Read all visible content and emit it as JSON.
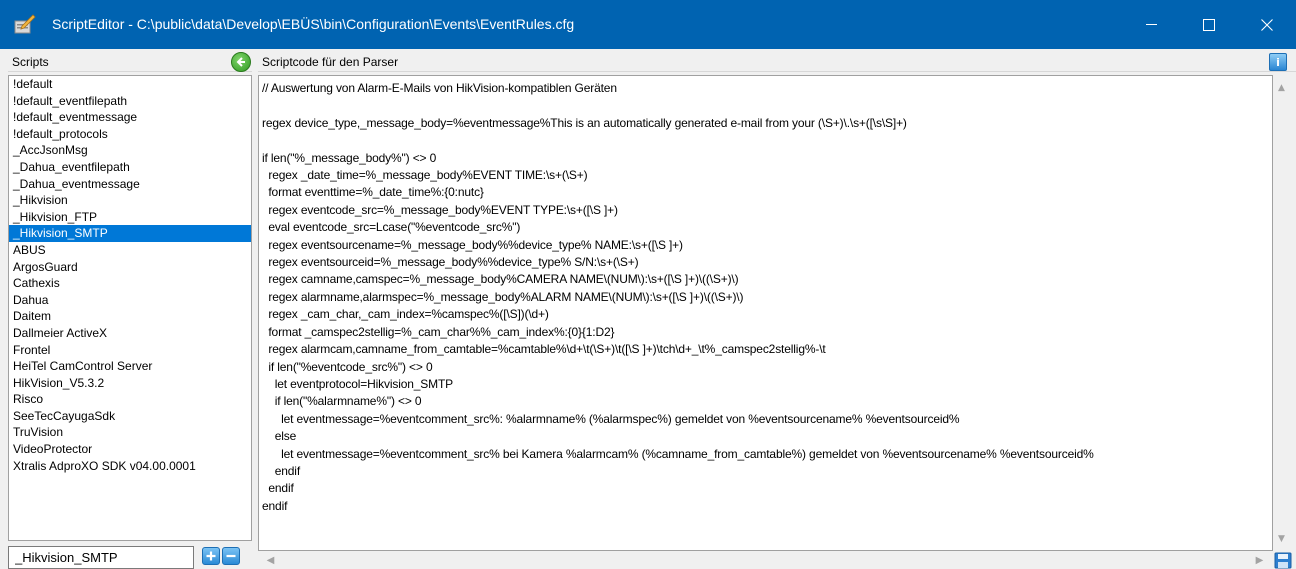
{
  "window": {
    "title": "ScriptEditor - C:\\public\\data\\Develop\\EBÜS\\bin\\Configuration\\Events\\EventRules.cfg",
    "accent": "#0063b1"
  },
  "left": {
    "header": "Scripts",
    "items": [
      "!default",
      "!default_eventfilepath",
      "!default_eventmessage",
      "!default_protocols",
      "_AccJsonMsg",
      "_Dahua_eventfilepath",
      "_Dahua_eventmessage",
      "_Hikvision",
      "_Hikvision_FTP",
      "_Hikvision_SMTP",
      "ABUS",
      "ArgosGuard",
      "Cathexis",
      "Dahua",
      "Daitem",
      "Dallmeier ActiveX",
      "Frontel",
      "HeiTel CamControl Server",
      "HikVision_V5.3.2",
      "Risco",
      "SeeTecCayugaSdk",
      "TruVision",
      "VideoProtector",
      "Xtralis AdproXO SDK v04.00.0001"
    ],
    "selected_index": 9,
    "name_field_value": "_Hikvision_SMTP"
  },
  "right": {
    "header": "Scriptcode für den Parser",
    "code_lines": [
      "// Auswertung von Alarm-E-Mails von HikVision-kompatiblen Geräten",
      "",
      "regex device_type,_message_body=%eventmessage%This is an automatically generated e-mail from your (\\S+)\\.\\s+([\\s\\S]+)",
      "",
      "if len(\"%_message_body%\") <> 0",
      "  regex _date_time=%_message_body%EVENT TIME:\\s+(\\S+)",
      "  format eventtime=%_date_time%:{0:nutc}",
      "  regex eventcode_src=%_message_body%EVENT TYPE:\\s+([\\S ]+)",
      "  eval eventcode_src=Lcase(\"%eventcode_src%\")",
      "  regex eventsourcename=%_message_body%%device_type% NAME:\\s+([\\S ]+)",
      "  regex eventsourceid=%_message_body%%device_type% S/N:\\s+(\\S+)",
      "  regex camname,camspec=%_message_body%CAMERA NAME\\(NUM\\):\\s+([\\S ]+)\\((\\S+)\\)",
      "  regex alarmname,alarmspec=%_message_body%ALARM NAME\\(NUM\\):\\s+([\\S ]+)\\((\\S+)\\)",
      "  regex _cam_char,_cam_index=%camspec%([\\S])(\\d+)",
      "  format _camspec2stellig=%_cam_char%%_cam_index%:{0}{1:D2}",
      "  regex alarmcam,camname_from_camtable=%camtable%\\d+\\t(\\S+)\\t([\\S ]+)\\tch\\d+_\\t%_camspec2stellig%-\\t",
      "  if len(\"%eventcode_src%\") <> 0",
      "    let eventprotocol=Hikvision_SMTP",
      "    if len(\"%alarmname%\") <> 0",
      "      let eventmessage=%eventcomment_src%: %alarmname% (%alarmspec%) gemeldet von %eventsourcename% %eventsourceid%",
      "    else",
      "      let eventmessage=%eventcomment_src% bei Kamera %alarmcam% (%camname_from_camtable%) gemeldet von %eventsourcename% %eventsourceid%",
      "    endif",
      "  endif",
      "endif"
    ]
  }
}
